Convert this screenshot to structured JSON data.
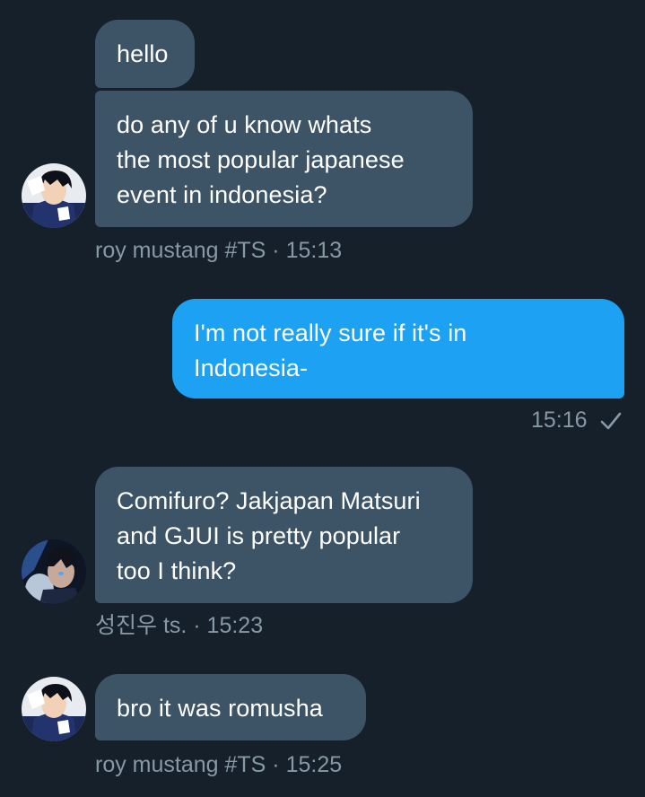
{
  "colors": {
    "background": "#15202b",
    "received_bubble": "#3d5466",
    "sent_bubble": "#1da1f2",
    "meta_text": "#8899a6"
  },
  "group1": {
    "messages": [
      "hello",
      "do any of u know whats\nthe most popular japanese\nevent in indonesia?"
    ],
    "sender_meta": "roy mustang #TS · 15:13",
    "avatar_icon": "roy-mustang-avatar"
  },
  "sent1": {
    "message": "I'm not really sure if it's in\nIndonesia-",
    "time": "15:16",
    "status_icon": "checkmark-icon"
  },
  "group2": {
    "messages": [
      "Comifuro? Jakjapan Matsuri\nand GJUI is pretty popular\ntoo I think?"
    ],
    "sender_meta": "성진우 ts. · 15:23",
    "avatar_icon": "sung-jinwoo-avatar"
  },
  "group3": {
    "messages": [
      "bro it was romusha"
    ],
    "sender_meta": "roy mustang #TS · 15:25",
    "avatar_icon": "roy-mustang-avatar"
  }
}
